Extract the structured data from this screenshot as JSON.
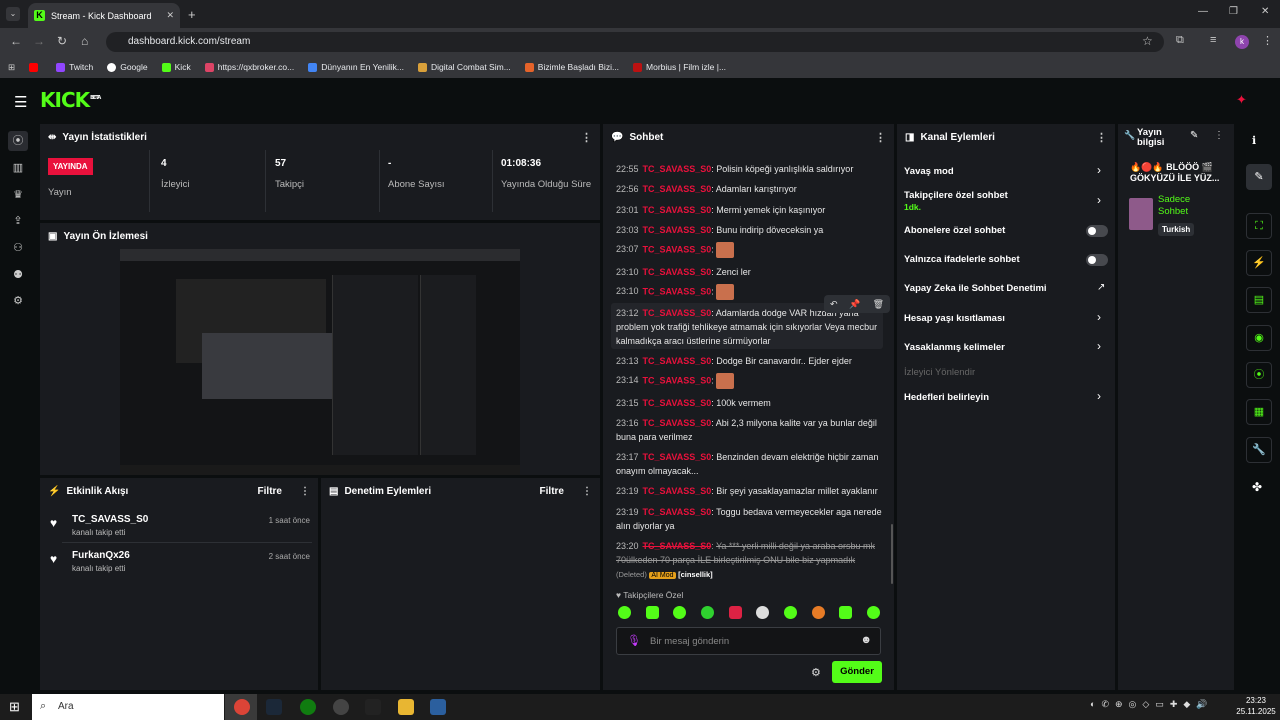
{
  "browser": {
    "tab_title": "Stream - Kick Dashboard",
    "url": "dashboard.kick.com/stream",
    "bookmarks": [
      "",
      "Twitch",
      "Google",
      "Kick",
      "https://qxbroker.co...",
      "Dünyanın En Yenilik...",
      "Digital Combat Sim...",
      "Bizimle Başladı Bizi...",
      "Morbius | Film izle |..."
    ]
  },
  "brand": {
    "logo": "KICK",
    "beta": "BETA"
  },
  "stats": {
    "title": "Yayın İstatistikleri",
    "live_badge": "YAYINDA",
    "live_label": "Yayın",
    "viewers": "4",
    "viewers_label": "İzleyici",
    "followers": "57",
    "followers_label": "Takipçi",
    "subs": "-",
    "subs_label": "Abone Sayısı",
    "uptime": "01:08:36",
    "uptime_label": "Yayında Olduğu Süre"
  },
  "preview": {
    "title": "Yayın Ön İzlemesi"
  },
  "activity": {
    "title": "Etkinlik Akışı",
    "filter": "Filtre",
    "items": [
      {
        "user": "TC_SAVASS_S0",
        "action": "kanalı takip etti",
        "time": "1 saat önce"
      },
      {
        "user": "FurkanQx26",
        "action": "kanalı takip etti",
        "time": "2 saat önce"
      }
    ]
  },
  "moderation": {
    "title": "Denetim Eylemleri",
    "filter": "Filtre"
  },
  "chat": {
    "title": "Sohbet",
    "messages": [
      {
        "time": "22:55",
        "user": "TC_SAVASS_S0",
        "text": "Polisin köpeği yanlışlıkla saldırıyor"
      },
      {
        "time": "22:56",
        "user": "TC_SAVASS_S0",
        "text": "Adamları karıştırıyor"
      },
      {
        "time": "23:01",
        "user": "TC_SAVASS_S0",
        "text": "Mermi yemek için kaşınıyor"
      },
      {
        "time": "23:03",
        "user": "TC_SAVASS_S0",
        "text": "Bunu indirip döveceksin ya"
      },
      {
        "time": "23:07",
        "user": "TC_SAVASS_S0",
        "text": ""
      },
      {
        "time": "23:10",
        "user": "TC_SAVASS_S0",
        "text": "Zenci ler"
      },
      {
        "time": "23:10",
        "user": "TC_SAVASS_S0",
        "text": ""
      },
      {
        "time": "23:12",
        "user": "TC_SAVASS_S0",
        "text": "Adamlarda dodge VAR hızdan yana problem yok trafiği tehlikeye atmamak için sıkıyorlar Veya mecbur kalmadıkça aracı üstlerine sürmüyorlar"
      },
      {
        "time": "23:13",
        "user": "TC_SAVASS_S0",
        "text": "Dodge Bir canavardır.. Ejder ejder"
      },
      {
        "time": "23:14",
        "user": "TC_SAVASS_S0",
        "text": ""
      },
      {
        "time": "23:15",
        "user": "TC_SAVASS_S0",
        "text": "100k vermem"
      },
      {
        "time": "23:16",
        "user": "TC_SAVASS_S0",
        "text": "Abi 2,3 milyona kalite var ya bunlar değil buna para verilmez"
      },
      {
        "time": "23:17",
        "user": "TC_SAVASS_S0",
        "text": "Benzinden devam elektriğe hiçbir zaman onayım olmayacak..."
      },
      {
        "time": "23:19",
        "user": "TC_SAVASS_S0",
        "text": "Bir şeyi yasaklayamazlar millet ayaklanır"
      },
      {
        "time": "23:19",
        "user": "TC_SAVASS_S0",
        "text": "Toggu bedava vermeyecekler aga nerede alın diyorlar ya"
      },
      {
        "time": "23:20",
        "user": "TC_SAVASS_S0",
        "text": "Ya *** yerli milli değil ya araba orsbu mk 70ülkeden 70 parça İLE birleştirilmiş ONU bile biz yapmadık"
      }
    ],
    "deleted": "(Deleted)",
    "ai_mod": "AI Mod",
    "reason": "[cinsellik]",
    "emote_label": "Takipçilere Özel",
    "placeholder": "Bir mesaj gönderin",
    "send": "Gönder"
  },
  "actions": {
    "title": "Kanal Eylemleri",
    "items": [
      "Yavaş mod",
      "Takipçilere özel sohbet",
      "Abonelere özel sohbet",
      "Yalnızca ifadelerle sohbet",
      "Yapay Zeka ile Sohbet Denetimi",
      "Hesap yaşı kısıtlaması",
      "Yasaklanmış kelimeler",
      "İzleyici Yönlendir",
      "Hedefleri belirleyin"
    ],
    "follower_sub": "1dk."
  },
  "info": {
    "title": "Yayın bilgisi",
    "stream_title": "🔥🔴🔥 BLÖÖÖ 🎬 GÖKYÜZÜ İLE YÜZ...",
    "category": "Sadece Sohbet",
    "tag": "Turkish"
  },
  "taskbar": {
    "search": "Ara",
    "time": "23:23",
    "date": "25.11.2025"
  },
  "colors": {
    "accent": "#53fc18",
    "live": "#e9113c",
    "panel": "#191b1f"
  }
}
